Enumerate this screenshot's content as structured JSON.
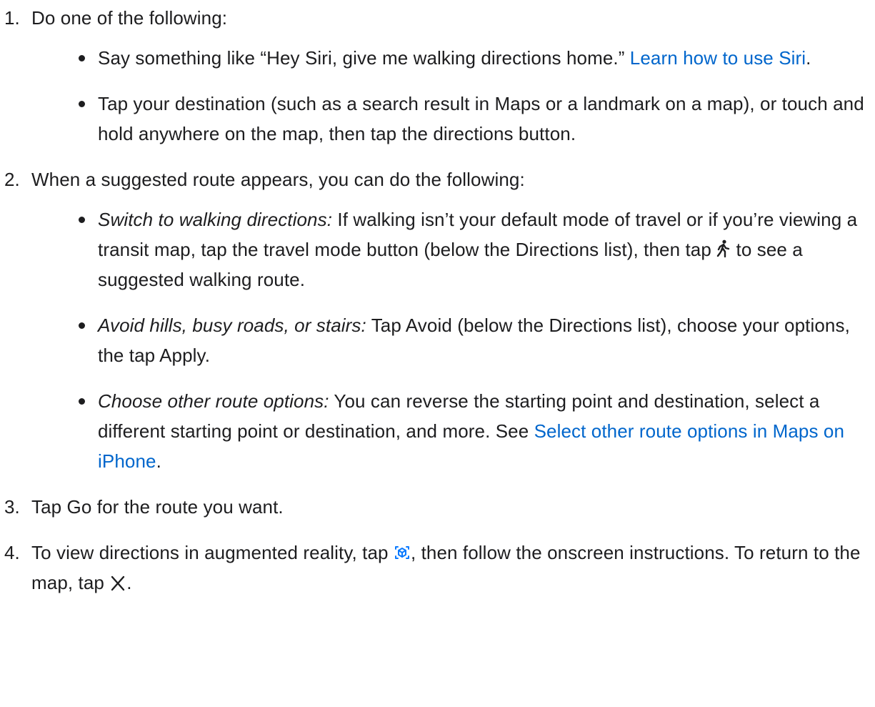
{
  "steps": [
    {
      "number": "1.",
      "text": "Do one of the following:",
      "items": [
        {
          "text": "Say something like “Hey Siri, give me walking directions home.” ",
          "link": "Learn how to use Siri",
          "after": "."
        },
        {
          "text": "Tap your destination (such as a search result in Maps or a landmark on a map), or touch and hold anywhere on the map, then tap the directions button."
        }
      ]
    },
    {
      "number": "2.",
      "text": "When a suggested route appears, you can do the following:",
      "items": [
        {
          "label": "Switch to walking directions:",
          "text_before_icon": " If walking isn’t your default mode of travel or if you’re viewing a transit map, tap the travel mode button (below the Directions list), then tap ",
          "icon": "walking-person-icon",
          "text_after_icon": " to see a suggested walking route."
        },
        {
          "label": "Avoid hills, busy roads, or stairs:",
          "text": " Tap Avoid (below the Directions list), choose your options, the tap Apply."
        },
        {
          "label": "Choose other route options:",
          "text": " You can reverse the starting point and destination, select a different starting point or destination, and more. See ",
          "link": "Select other route options in Maps on iPhone",
          "after": "."
        }
      ]
    },
    {
      "number": "3.",
      "text": "Tap Go for the route you want."
    },
    {
      "number": "4.",
      "text_before_ar_icon": "To view directions in augmented reality, tap ",
      "ar_icon": "ar-view-icon",
      "text_middle": ", then follow the onscreen instructions. To return to the map, tap ",
      "close_icon": "close-icon",
      "after": "."
    }
  ],
  "colors": {
    "text": "#1d1d1f",
    "link": "#0066cc"
  }
}
